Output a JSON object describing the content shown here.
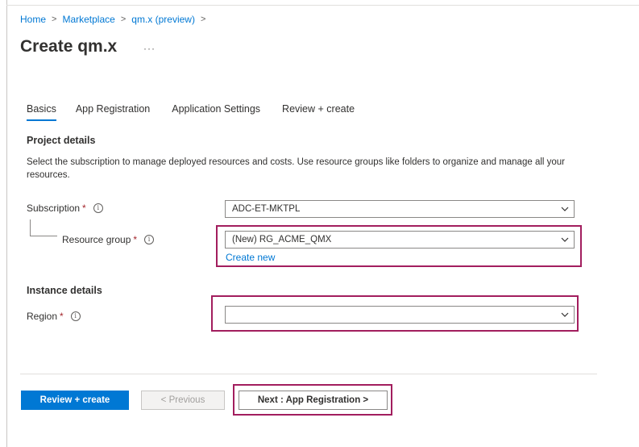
{
  "breadcrumb": {
    "home": "Home",
    "marketplace": "Marketplace",
    "preview": "qm.x (preview)",
    "sep": ">"
  },
  "page": {
    "title": "Create qm.x",
    "more": "···"
  },
  "tabs": [
    {
      "label": "Basics",
      "active": true
    },
    {
      "label": "App Registration",
      "active": false
    },
    {
      "label": "Application Settings",
      "active": false
    },
    {
      "label": "Review + create",
      "active": false
    }
  ],
  "project": {
    "heading": "Project details",
    "description": "Select the subscription to manage deployed resources and costs. Use resource groups like folders to organize and manage all your resources.",
    "subscription_label": "Subscription",
    "subscription_value": "ADC-ET-MKTPL",
    "resource_group_label": "Resource group",
    "resource_group_value": "(New) RG_ACME_QMX",
    "create_new": "Create new"
  },
  "instance": {
    "heading": "Instance details",
    "region_label": "Region",
    "region_value": ""
  },
  "footer": {
    "review_create": "Review + create",
    "previous": "< Previous",
    "next": "Next : App Registration >"
  },
  "required_mark": "*",
  "info_glyph": "i",
  "colors": {
    "accent": "#0078d4",
    "highlight": "#a21e5e",
    "required": "#a4262c"
  }
}
